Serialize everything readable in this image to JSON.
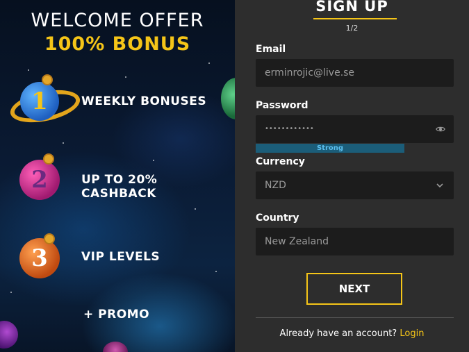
{
  "promo": {
    "welcome_title": "WELCOME OFFER",
    "bonus_title": "100% BONUS",
    "features": [
      {
        "number": "1",
        "label": "WEEKLY BONUSES"
      },
      {
        "number": "2",
        "label": "UP TO 20% CASHBACK"
      },
      {
        "number": "3",
        "label": "VIP LEVELS"
      },
      {
        "label": "+ PROMO"
      }
    ]
  },
  "form": {
    "title": "SIGN UP",
    "step": "1/2",
    "email_label": "Email",
    "email_value": "erminrojic@live.se",
    "password_label": "Password",
    "password_value": "••••••••••••",
    "password_strength": "Strong",
    "currency_label": "Currency",
    "currency_value": "NZD",
    "country_label": "Country",
    "country_value": "New Zealand",
    "next_label": "NEXT",
    "footer_text": "Already have an account?",
    "login_label": "Login"
  },
  "colors": {
    "accent": "#f5c518",
    "strength_bar": "#1b5d79",
    "field_bg": "#1c1c1c"
  }
}
